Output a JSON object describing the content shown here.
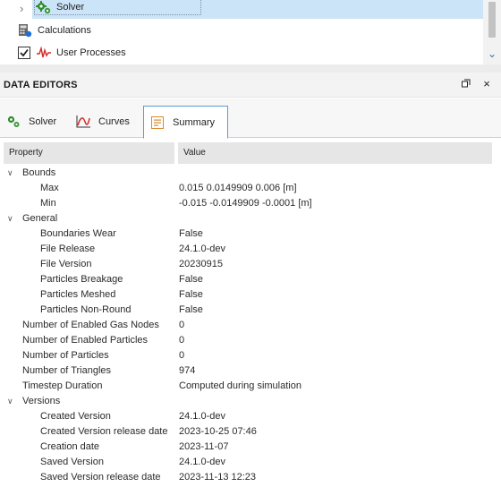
{
  "tree": {
    "items": [
      {
        "label": "Solver",
        "icon": "gears-icon",
        "selected": true
      },
      {
        "label": "Calculations",
        "icon": "calculator-icon"
      },
      {
        "label": "User Processes",
        "icon": "process-wave-icon",
        "checked": true
      }
    ]
  },
  "panel": {
    "title": "DATA EDITORS",
    "tabs": [
      {
        "label": "Solver",
        "icon": "gears-icon"
      },
      {
        "label": "Curves",
        "icon": "chart-curve-icon"
      },
      {
        "label": "Summary",
        "icon": "summary-document-icon",
        "active": true
      }
    ]
  },
  "grid": {
    "col_property": "Property",
    "col_value": "Value",
    "rows": [
      {
        "level": 0,
        "group": true,
        "name": "Bounds",
        "value": ""
      },
      {
        "level": 1,
        "name": "Max",
        "value": "0.015 0.0149909 0.006 [m]"
      },
      {
        "level": 1,
        "name": "Min",
        "value": "-0.015 -0.0149909 -0.0001 [m]"
      },
      {
        "level": 0,
        "group": true,
        "name": "General",
        "value": ""
      },
      {
        "level": 1,
        "name": "Boundaries Wear",
        "value": "False"
      },
      {
        "level": 1,
        "name": "File Release",
        "value": "24.1.0-dev"
      },
      {
        "level": 1,
        "name": "File Version",
        "value": "20230915"
      },
      {
        "level": 1,
        "name": "Particles Breakage",
        "value": "False"
      },
      {
        "level": 1,
        "name": "Particles Meshed",
        "value": "False"
      },
      {
        "level": 1,
        "name": "Particles Non-Round",
        "value": "False"
      },
      {
        "level": 0,
        "name": "Number of Enabled Gas Nodes",
        "value": "0"
      },
      {
        "level": 0,
        "name": "Number of Enabled Particles",
        "value": "0"
      },
      {
        "level": 0,
        "name": "Number of Particles",
        "value": "0"
      },
      {
        "level": 0,
        "name": "Number of Triangles",
        "value": "974"
      },
      {
        "level": 0,
        "name": "Timestep Duration",
        "value": "Computed during simulation"
      },
      {
        "level": 0,
        "group": true,
        "name": "Versions",
        "value": ""
      },
      {
        "level": 1,
        "name": "Created Version",
        "value": "24.1.0-dev"
      },
      {
        "level": 1,
        "name": "Created Version release date",
        "value": "2023-10-25 07:46"
      },
      {
        "level": 1,
        "name": "Creation date",
        "value": "2023-11-07"
      },
      {
        "level": 1,
        "name": "Saved Version",
        "value": "24.1.0-dev"
      },
      {
        "level": 1,
        "name": "Saved Version release date",
        "value": "2023-11-13 12:23"
      }
    ]
  }
}
